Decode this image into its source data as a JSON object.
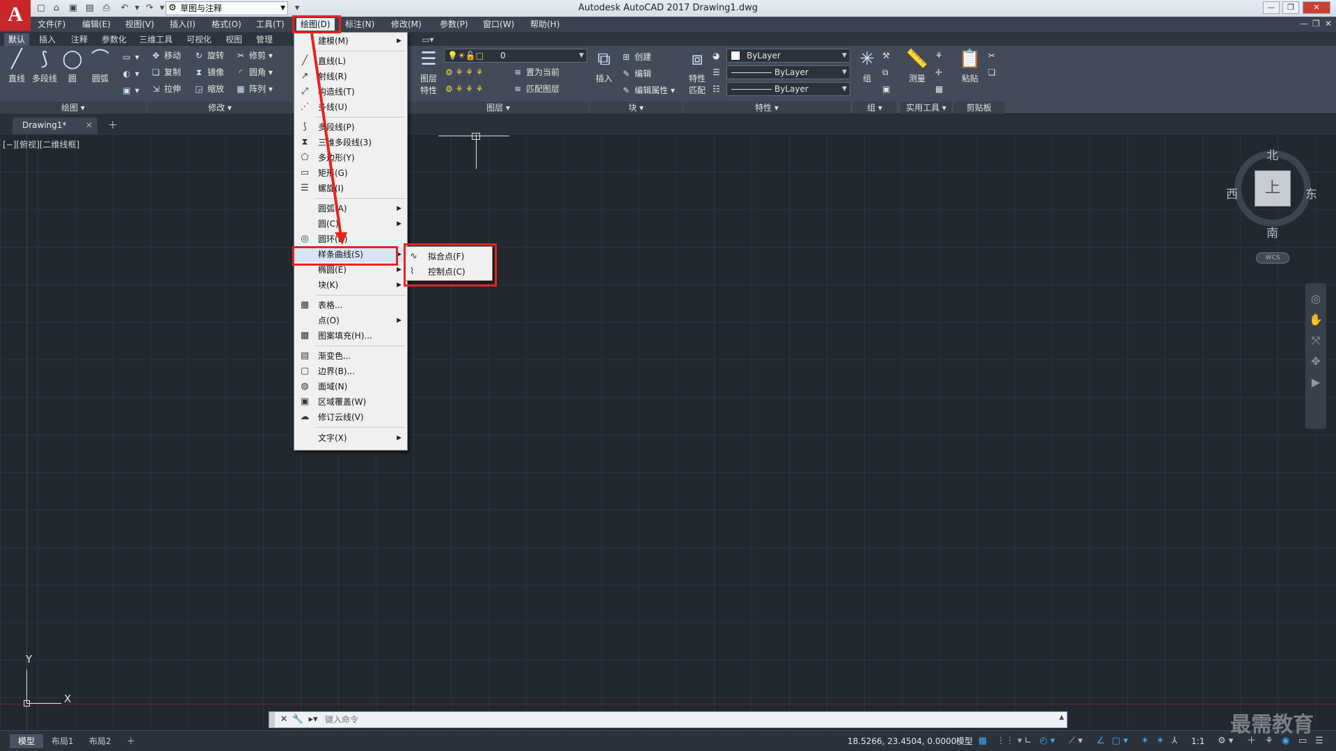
{
  "title_bar": {
    "app_logo": "A",
    "workspace": "草图与注释",
    "title": "Autodesk AutoCAD 2017    Drawing1.dwg"
  },
  "menu_bar": {
    "items": [
      "文件(F)",
      "编辑(E)",
      "视图(V)",
      "插入(I)",
      "格式(O)",
      "工具(T)",
      "绘图(D)",
      "标注(N)",
      "修改(M)",
      "参数(P)",
      "窗口(W)",
      "帮助(H)"
    ]
  },
  "ribbon_tabs": [
    "默认",
    "插入",
    "注释",
    "参数化",
    "三维工具",
    "可视化",
    "视图",
    "管理"
  ],
  "ribbon": {
    "draw_panel": {
      "title": "绘图",
      "tools": [
        "直线",
        "多段线",
        "圆",
        "圆弧"
      ]
    },
    "modify_panel": {
      "title": "修改",
      "tools": [
        "移动",
        "旋转",
        "修剪",
        "复制",
        "镜像",
        "圆角",
        "拉伸",
        "缩放",
        "阵列"
      ]
    },
    "layer_panel": {
      "title": "图层",
      "big_tool": "图层\n特性",
      "layer_value": "0",
      "tools": [
        "置为当前",
        "匹配图层"
      ]
    },
    "block_panel": {
      "title": "块",
      "big_tool": "插入",
      "tools": [
        "创建",
        "编辑",
        "编辑属性"
      ]
    },
    "properties_panel": {
      "title": "特性",
      "big_tool": "特性\n匹配",
      "combos": [
        "ByLayer",
        "ByLayer",
        "ByLayer"
      ]
    },
    "group_panel": {
      "title": "组",
      "big_tool": "组"
    },
    "utilities_panel": {
      "title": "实用工具",
      "big_tool": "测量"
    },
    "clipboard_panel": {
      "title": "剪贴板",
      "big_tool": "粘贴"
    }
  },
  "file_tab": {
    "name": "Drawing1*"
  },
  "canvas": {
    "view_label": "[−][俯视][二维线框]",
    "ucs": {
      "x_label": "X",
      "y_label": "Y"
    },
    "viewcube": {
      "face": "上",
      "north": "北",
      "south": "南",
      "east": "东",
      "west": "西",
      "wcs": "WCS"
    }
  },
  "draw_menu": {
    "items": [
      {
        "label": "建模(M)",
        "icon": "none",
        "submenu": true
      },
      {
        "label": "直线(L)",
        "icon": "line-icon",
        "submenu": false
      },
      {
        "label": "射线(R)",
        "icon": "ray-icon",
        "submenu": false
      },
      {
        "label": "构造线(T)",
        "icon": "xline-icon",
        "submenu": false
      },
      {
        "label": "多线(U)",
        "icon": "mline-icon",
        "submenu": false
      },
      {
        "label": "多段线(P)",
        "icon": "polyline-icon",
        "submenu": false
      },
      {
        "label": "三维多段线(3)",
        "icon": "3dpoly-icon",
        "submenu": false
      },
      {
        "label": "多边形(Y)",
        "icon": "polygon-icon",
        "submenu": false
      },
      {
        "label": "矩形(G)",
        "icon": "rectangle-icon",
        "submenu": false
      },
      {
        "label": "螺旋(I)",
        "icon": "helix-icon",
        "submenu": false
      },
      {
        "label": "圆弧(A)",
        "icon": "none",
        "submenu": true
      },
      {
        "label": "圆(C)",
        "icon": "none",
        "submenu": true
      },
      {
        "label": "圆环(D)",
        "icon": "donut-icon",
        "submenu": false
      },
      {
        "label": "样条曲线(S)",
        "icon": "none",
        "submenu": true
      },
      {
        "label": "椭圆(E)",
        "icon": "none",
        "submenu": true
      },
      {
        "label": "块(K)",
        "icon": "none",
        "submenu": true
      },
      {
        "label": "表格...",
        "icon": "table-icon",
        "submenu": false
      },
      {
        "label": "点(O)",
        "icon": "none",
        "submenu": true
      },
      {
        "label": "图案填充(H)...",
        "icon": "hatch-icon",
        "submenu": false
      },
      {
        "label": "渐变色...",
        "icon": "gradient-icon",
        "submenu": false
      },
      {
        "label": "边界(B)...",
        "icon": "boundary-icon",
        "submenu": false
      },
      {
        "label": "面域(N)",
        "icon": "region-icon",
        "submenu": false
      },
      {
        "label": "区域覆盖(W)",
        "icon": "wipeout-icon",
        "submenu": false
      },
      {
        "label": "修订云线(V)",
        "icon": "revcloud-icon",
        "submenu": false
      },
      {
        "label": "文字(X)",
        "icon": "none",
        "submenu": true
      }
    ]
  },
  "spline_submenu": {
    "items": [
      "拟合点(F)",
      "控制点(C)"
    ]
  },
  "command_line": {
    "placeholder": "键入命令"
  },
  "status_bar": {
    "layout_tabs": [
      "模型",
      "布局1",
      "布局2"
    ],
    "coordinates": "18.5266, 23.4504, 0.0000",
    "model": "模型",
    "scale": "1:1"
  },
  "watermark": "最需教育"
}
